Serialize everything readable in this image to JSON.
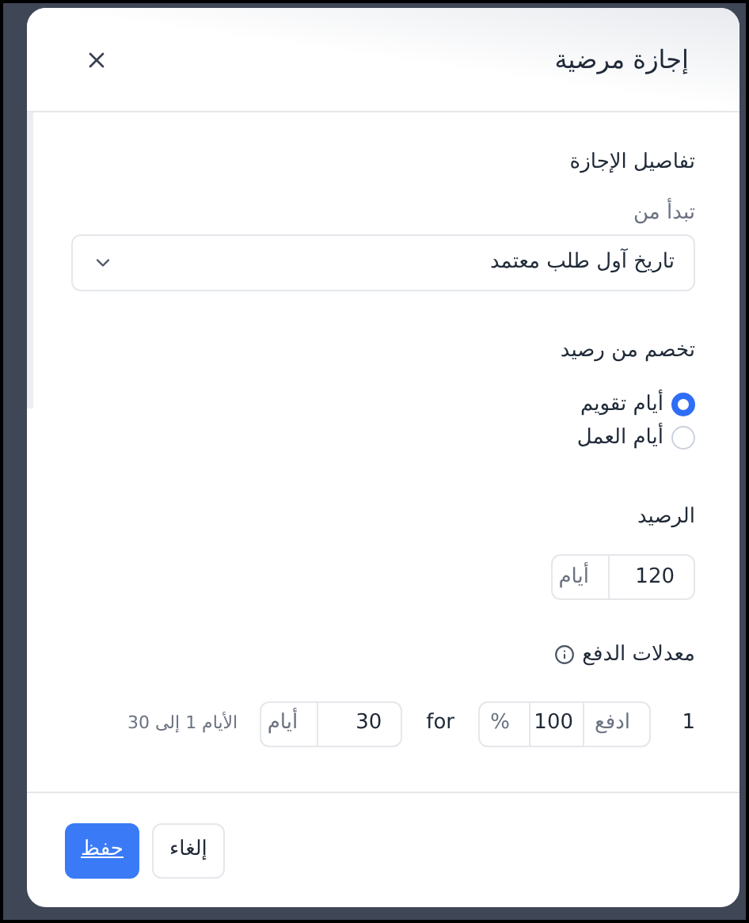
{
  "dialog": {
    "title": "إجازة مرضية"
  },
  "section": {
    "title": "تفاصيل الإجازة"
  },
  "start": {
    "label": "تبدأ من",
    "value": "تاريخ آول طلب معتمد"
  },
  "deduct": {
    "label": "تخصم من رصيد",
    "options": [
      {
        "label": "أيام تقويم",
        "selected": true
      },
      {
        "label": "أيام العمل",
        "selected": false
      }
    ]
  },
  "balance": {
    "label": "الرصيد",
    "value": "120",
    "unit": "أيام"
  },
  "rates": {
    "label": "معدلات الدفع",
    "rows": [
      {
        "index": "1",
        "pay_label": "ادفع",
        "percent": "100",
        "percent_unit": "%",
        "for": "for",
        "days": "30",
        "days_unit": "أيام",
        "range": "الأيام 1 إلى 30"
      }
    ]
  },
  "buttons": {
    "save": "حفظ",
    "cancel": "إلغاء"
  }
}
